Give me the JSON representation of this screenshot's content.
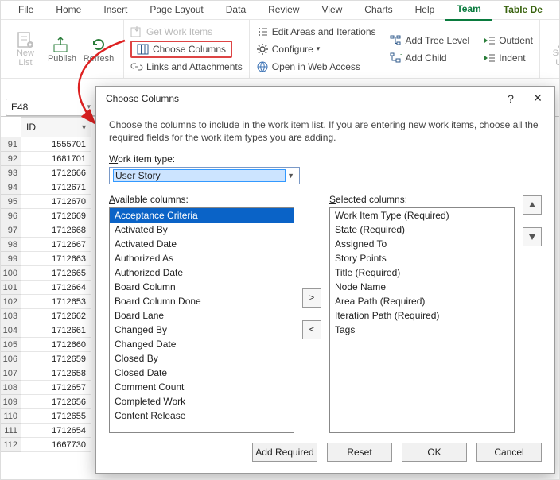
{
  "tabs": [
    "File",
    "Home",
    "Insert",
    "Page Layout",
    "Data",
    "Review",
    "View",
    "Charts",
    "Help",
    "Team",
    "Table De"
  ],
  "active_tab_index": 9,
  "ribbon": {
    "new_list": "New\nList",
    "publish": "Publish",
    "refresh": "Refresh",
    "get_work_items": "Get Work Items",
    "choose_columns": "Choose Columns",
    "links_attachments": "Links and Attachments",
    "edit_areas": "Edit Areas and Iterations",
    "configure": "Configure",
    "open_web": "Open in Web Access",
    "add_tree": "Add Tree Level",
    "add_child": "Add Child",
    "outdent": "Outdent",
    "indent": "Indent",
    "select_user": "Select\nUser"
  },
  "namebox": "E48",
  "col_header": "ID",
  "row_start": 91,
  "ids": [
    "1555701",
    "1681701",
    "1712666",
    "1712671",
    "1712670",
    "1712669",
    "1712668",
    "1712667",
    "1712663",
    "1712665",
    "1712664",
    "1712653",
    "1712662",
    "1712661",
    "1712660",
    "1712659",
    "1712658",
    "1712657",
    "1712656",
    "1712655",
    "1712654",
    "1667730"
  ],
  "dialog": {
    "title": "Choose Columns",
    "instr": "Choose the columns to include in the work item list.  If you are entering new work items, choose all the required fields for the work item types you are adding.",
    "work_item_type_label": "Work item type:",
    "work_item_type_value": "User Story",
    "available_label": "Available columns:",
    "selected_label": "Selected columns:",
    "available": [
      "Acceptance Criteria",
      "Activated By",
      "Activated Date",
      "Authorized As",
      "Authorized Date",
      "Board Column",
      "Board Column Done",
      "Board Lane",
      "Changed By",
      "Changed Date",
      "Closed By",
      "Closed Date",
      "Comment Count",
      "Completed Work",
      "Content Release"
    ],
    "selected": [
      "Work Item Type (Required)",
      "State (Required)",
      "Assigned To",
      "Story Points",
      "Title (Required)",
      "Node Name",
      "Area Path (Required)",
      "Iteration Path (Required)",
      "Tags"
    ],
    "buttons": {
      "add_required": "Add Required",
      "reset": "Reset",
      "ok": "OK",
      "cancel": "Cancel"
    }
  }
}
